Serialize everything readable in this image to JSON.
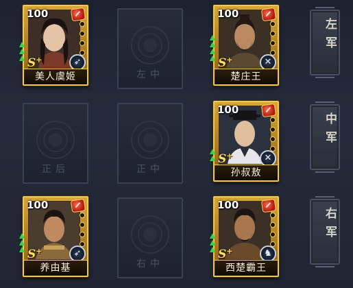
{
  "slots": [
    {
      "id": "r1c1",
      "filled": true,
      "name": "美人虞姬",
      "level": "100",
      "grade": "S",
      "grade_plus": "+",
      "class_icon": "bow-icon",
      "upgrades": 3,
      "skin": "#e4c3a6",
      "hair": "#1a1110",
      "beard": false
    },
    {
      "id": "r1c2",
      "filled": false,
      "label": "左中"
    },
    {
      "id": "r1c3",
      "filled": true,
      "name": "楚庄王",
      "level": "100",
      "grade": "S",
      "grade_plus": "+",
      "class_icon": "spear-icon",
      "upgrades": 4,
      "skin": "#b98a62",
      "hair": "#231814",
      "beard": true
    },
    {
      "id": "r2c1",
      "filled": false,
      "label": ""
    },
    {
      "id": "r2c2",
      "filled": false,
      "label": ""
    },
    {
      "id": "r2c3",
      "filled": true,
      "name": "孙叔敖",
      "level": "100",
      "grade": "S",
      "grade_plus": "+",
      "class_icon": "spear-icon",
      "upgrades": 2,
      "skin": "#e0c09c",
      "hair": "#151515",
      "beard": false
    },
    {
      "id": "r3c1",
      "filled": true,
      "name": "养由基",
      "level": "100",
      "grade": "S",
      "grade_plus": "+",
      "class_icon": "bow-icon",
      "upgrades": 3,
      "skin": "#c08a60",
      "hair": "#1b1410",
      "beard": false
    },
    {
      "id": "r3c2",
      "filled": false,
      "label": "右中"
    },
    {
      "id": "r3c3",
      "filled": true,
      "name": "西楚霸王",
      "level": "100",
      "grade": "S",
      "grade_plus": "+",
      "class_icon": "horse-icon",
      "upgrades": 3,
      "skin": "#a9774f",
      "hair": "#1c1410",
      "beard": true
    }
  ],
  "empty_labels": {
    "r2c1": "正后",
    "r2c2": "正中"
  },
  "armies": [
    {
      "id": "left",
      "label": "左军"
    },
    {
      "id": "center",
      "label": "中军"
    },
    {
      "id": "right",
      "label": "右军"
    }
  ]
}
